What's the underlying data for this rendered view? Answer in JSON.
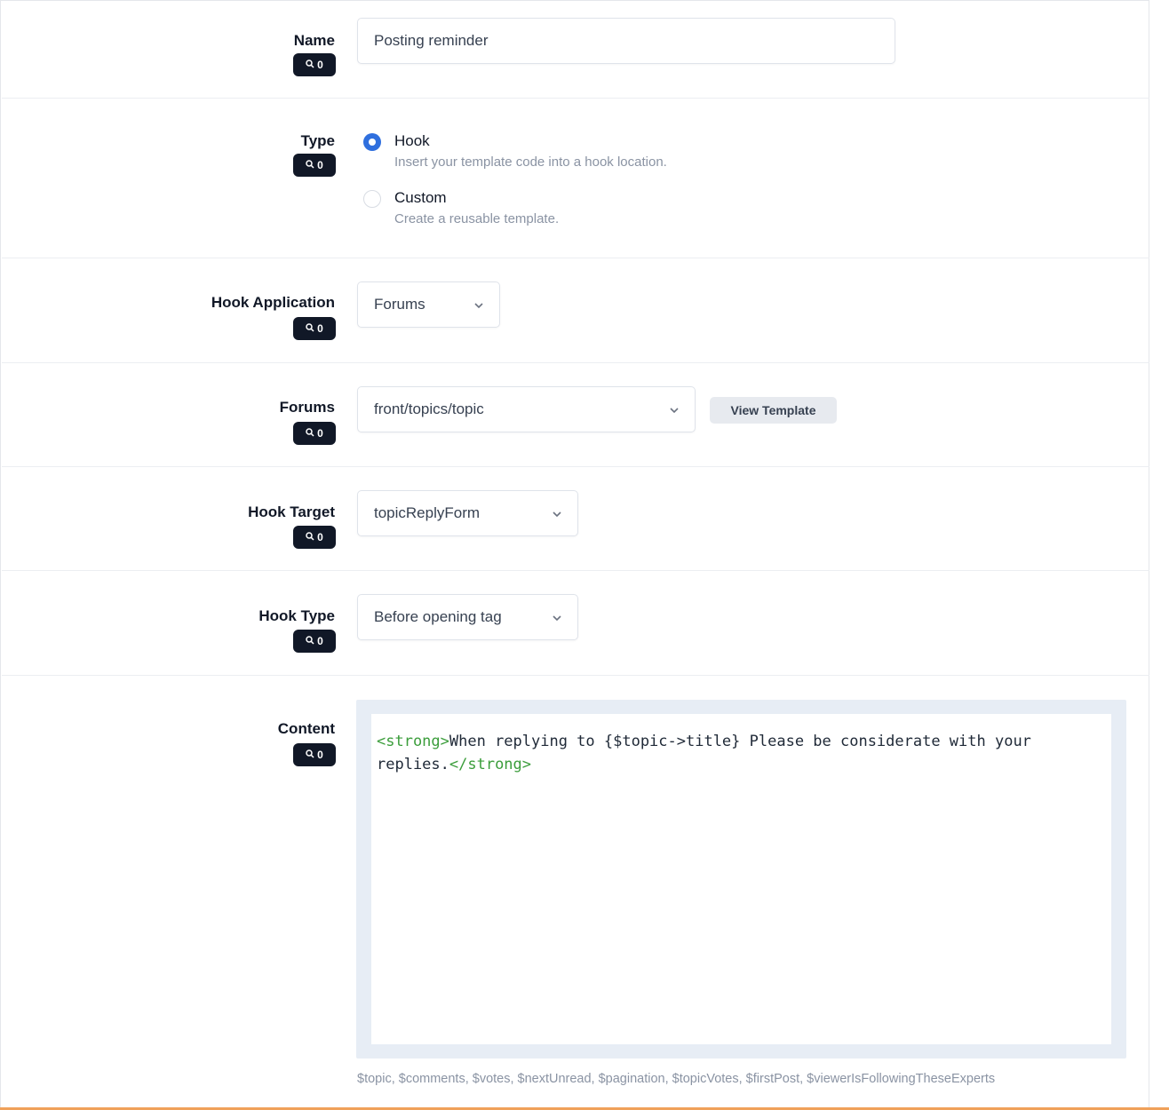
{
  "fields": {
    "name": {
      "label": "Name",
      "badge_count": "0",
      "value": "Posting reminder"
    },
    "type": {
      "label": "Type",
      "badge_count": "0",
      "options": [
        {
          "title": "Hook",
          "description": "Insert your template code into a hook location.",
          "checked": true
        },
        {
          "title": "Custom",
          "description": "Create a reusable template.",
          "checked": false
        }
      ]
    },
    "hook_application": {
      "label": "Hook Application",
      "badge_count": "0",
      "value": "Forums"
    },
    "forums": {
      "label": "Forums",
      "badge_count": "0",
      "value": "front/topics/topic",
      "button_label": "View Template"
    },
    "hook_target": {
      "label": "Hook Target",
      "badge_count": "0",
      "value": "topicReplyForm"
    },
    "hook_type": {
      "label": "Hook Type",
      "badge_count": "0",
      "value": "Before opening tag"
    },
    "content": {
      "label": "Content",
      "badge_count": "0",
      "code_open_tag": "<strong>",
      "code_text": "When replying to {$topic->title} Please be considerate with your replies.",
      "code_close_tag": "</strong>",
      "variables": "$topic, $comments, $votes, $nextUnread, $pagination, $topicVotes, $firstPost, $viewerIsFollowingTheseExperts"
    }
  },
  "colors": {
    "accent": "#2f6fde",
    "badge_bg": "#111827",
    "code_tag": "#3b9d3b",
    "bottom_accent": "#f0a15a"
  },
  "icons": {
    "badge": "search-icon",
    "select": "chevron-down-icon"
  }
}
